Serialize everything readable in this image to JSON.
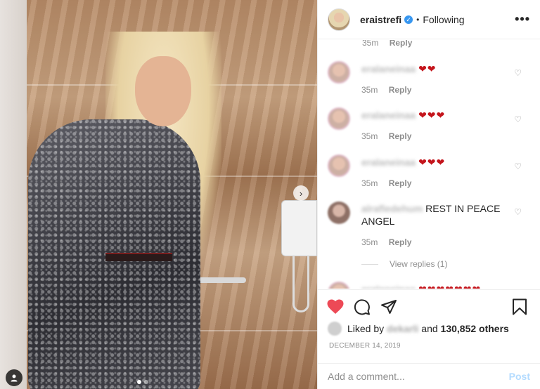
{
  "header": {
    "username": "eraistrefi",
    "separator": "•",
    "following_label": "Following",
    "more_label": "•••"
  },
  "comments": {
    "top_cut": {
      "time": "35m",
      "reply_label": "Reply"
    },
    "items": [
      {
        "user": "eralaneinaa",
        "text": "",
        "hearts": "❤❤",
        "time": "35m",
        "reply_label": "Reply"
      },
      {
        "user": "eralaneinaa",
        "text": "",
        "hearts": "❤❤❤",
        "time": "35m",
        "reply_label": "Reply"
      },
      {
        "user": "eralaneinaa",
        "text": "",
        "hearts": "❤❤❤",
        "time": "35m",
        "reply_label": "Reply"
      },
      {
        "user": "alrafledehum",
        "text": "REST IN PEACE ANGEL",
        "hearts": "",
        "time": "35m",
        "reply_label": "Reply",
        "view_replies": "View replies (1)"
      },
      {
        "user": "eralaneinaa",
        "text": "",
        "hearts": "❤❤❤❤❤❤❤"
      }
    ]
  },
  "likes": {
    "prefix": "Liked by",
    "liker": "dekarli",
    "suffix": "and",
    "count": "130,852 others"
  },
  "date": "DECEMBER 14, 2019",
  "add_comment": {
    "placeholder": "Add a comment...",
    "post_label": "Post"
  },
  "photo": {
    "dots_total": 2,
    "dots_active_index": 0
  },
  "colors": {
    "accent_link": "#3897f0",
    "like_red": "#ed4956",
    "post_disabled": "#b3dbff"
  }
}
